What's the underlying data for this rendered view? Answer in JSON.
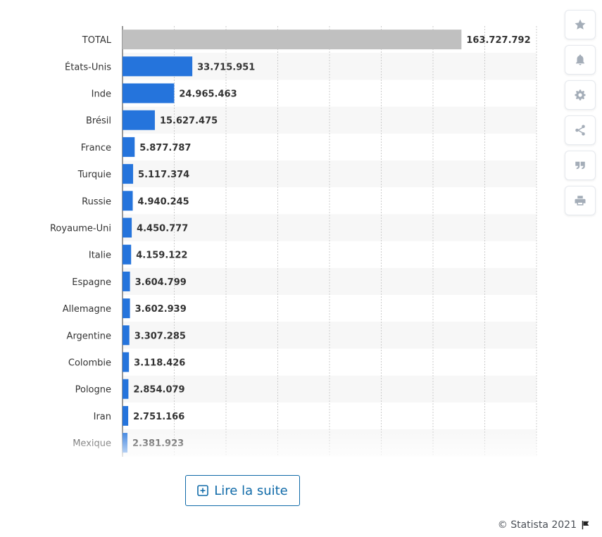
{
  "chart_data": {
    "type": "bar",
    "orientation": "horizontal",
    "categories": [
      "TOTAL",
      "États-Unis",
      "Inde",
      "Brésil",
      "France",
      "Turquie",
      "Russie",
      "Royaume-Uni",
      "Italie",
      "Espagne",
      "Allemagne",
      "Argentine",
      "Colombie",
      "Pologne",
      "Iran",
      "Mexique"
    ],
    "values": [
      163727792,
      33715951,
      24965463,
      15627475,
      5877787,
      5117374,
      4940245,
      4450777,
      4159122,
      3604799,
      3602939,
      3307285,
      3118426,
      2854079,
      2751166,
      2381923
    ],
    "value_labels": [
      "163.727.792",
      "33.715.951",
      "24.965.463",
      "15.627.475",
      "5.877.787",
      "5.117.374",
      "4.940.245",
      "4.450.777",
      "4.159.122",
      "3.604.799",
      "3.602.939",
      "3.307.285",
      "3.118.426",
      "2.854.079",
      "2.751.166",
      "2.381.923"
    ],
    "xlim": [
      0,
      200000000
    ],
    "grid": true,
    "title": "",
    "xlabel": "",
    "ylabel": "",
    "colors": {
      "total": "#c0c0c0",
      "bar": "#2574dc",
      "gridline": "#cccccc",
      "stripe": "#f7f7f7"
    }
  },
  "toolbar": {
    "items": [
      {
        "icon": "star-icon"
      },
      {
        "icon": "bell-icon"
      },
      {
        "icon": "gear-icon"
      },
      {
        "icon": "share-icon"
      },
      {
        "icon": "quote-icon"
      },
      {
        "icon": "print-icon"
      }
    ]
  },
  "read_more": {
    "label": "Lire la suite",
    "color": "#0f6aa8"
  },
  "footer": {
    "credit": "© Statista 2021"
  }
}
